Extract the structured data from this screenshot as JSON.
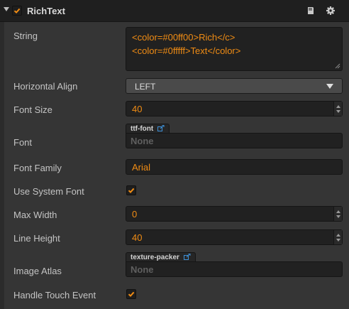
{
  "header": {
    "component_name": "RichText",
    "enabled": true,
    "icons": [
      "book-icon",
      "gear-icon"
    ]
  },
  "properties": {
    "string": {
      "label": "String",
      "lines": [
        "<color=#00ff00>Rich</c>",
        "<color=#0fffff>Text</color>"
      ]
    },
    "horizontal_align": {
      "label": "Horizontal Align",
      "value": "LEFT"
    },
    "font_size": {
      "label": "Font Size",
      "value": "40"
    },
    "font": {
      "label": "Font",
      "asset_type": "ttf-font",
      "value": "None"
    },
    "font_family": {
      "label": "Font Family",
      "value": "Arial"
    },
    "use_system_font": {
      "label": "Use System Font",
      "checked": true
    },
    "max_width": {
      "label": "Max Width",
      "value": "0"
    },
    "line_height": {
      "label": "Line Height",
      "value": "40"
    },
    "image_atlas": {
      "label": "Image Atlas",
      "asset_type": "texture-packer",
      "value": "None"
    },
    "handle_touch_event": {
      "label": "Handle Touch Event",
      "checked": true
    }
  },
  "colors": {
    "accent": "#f08c14",
    "panel": "#353535",
    "header": "#1f1f1f"
  }
}
